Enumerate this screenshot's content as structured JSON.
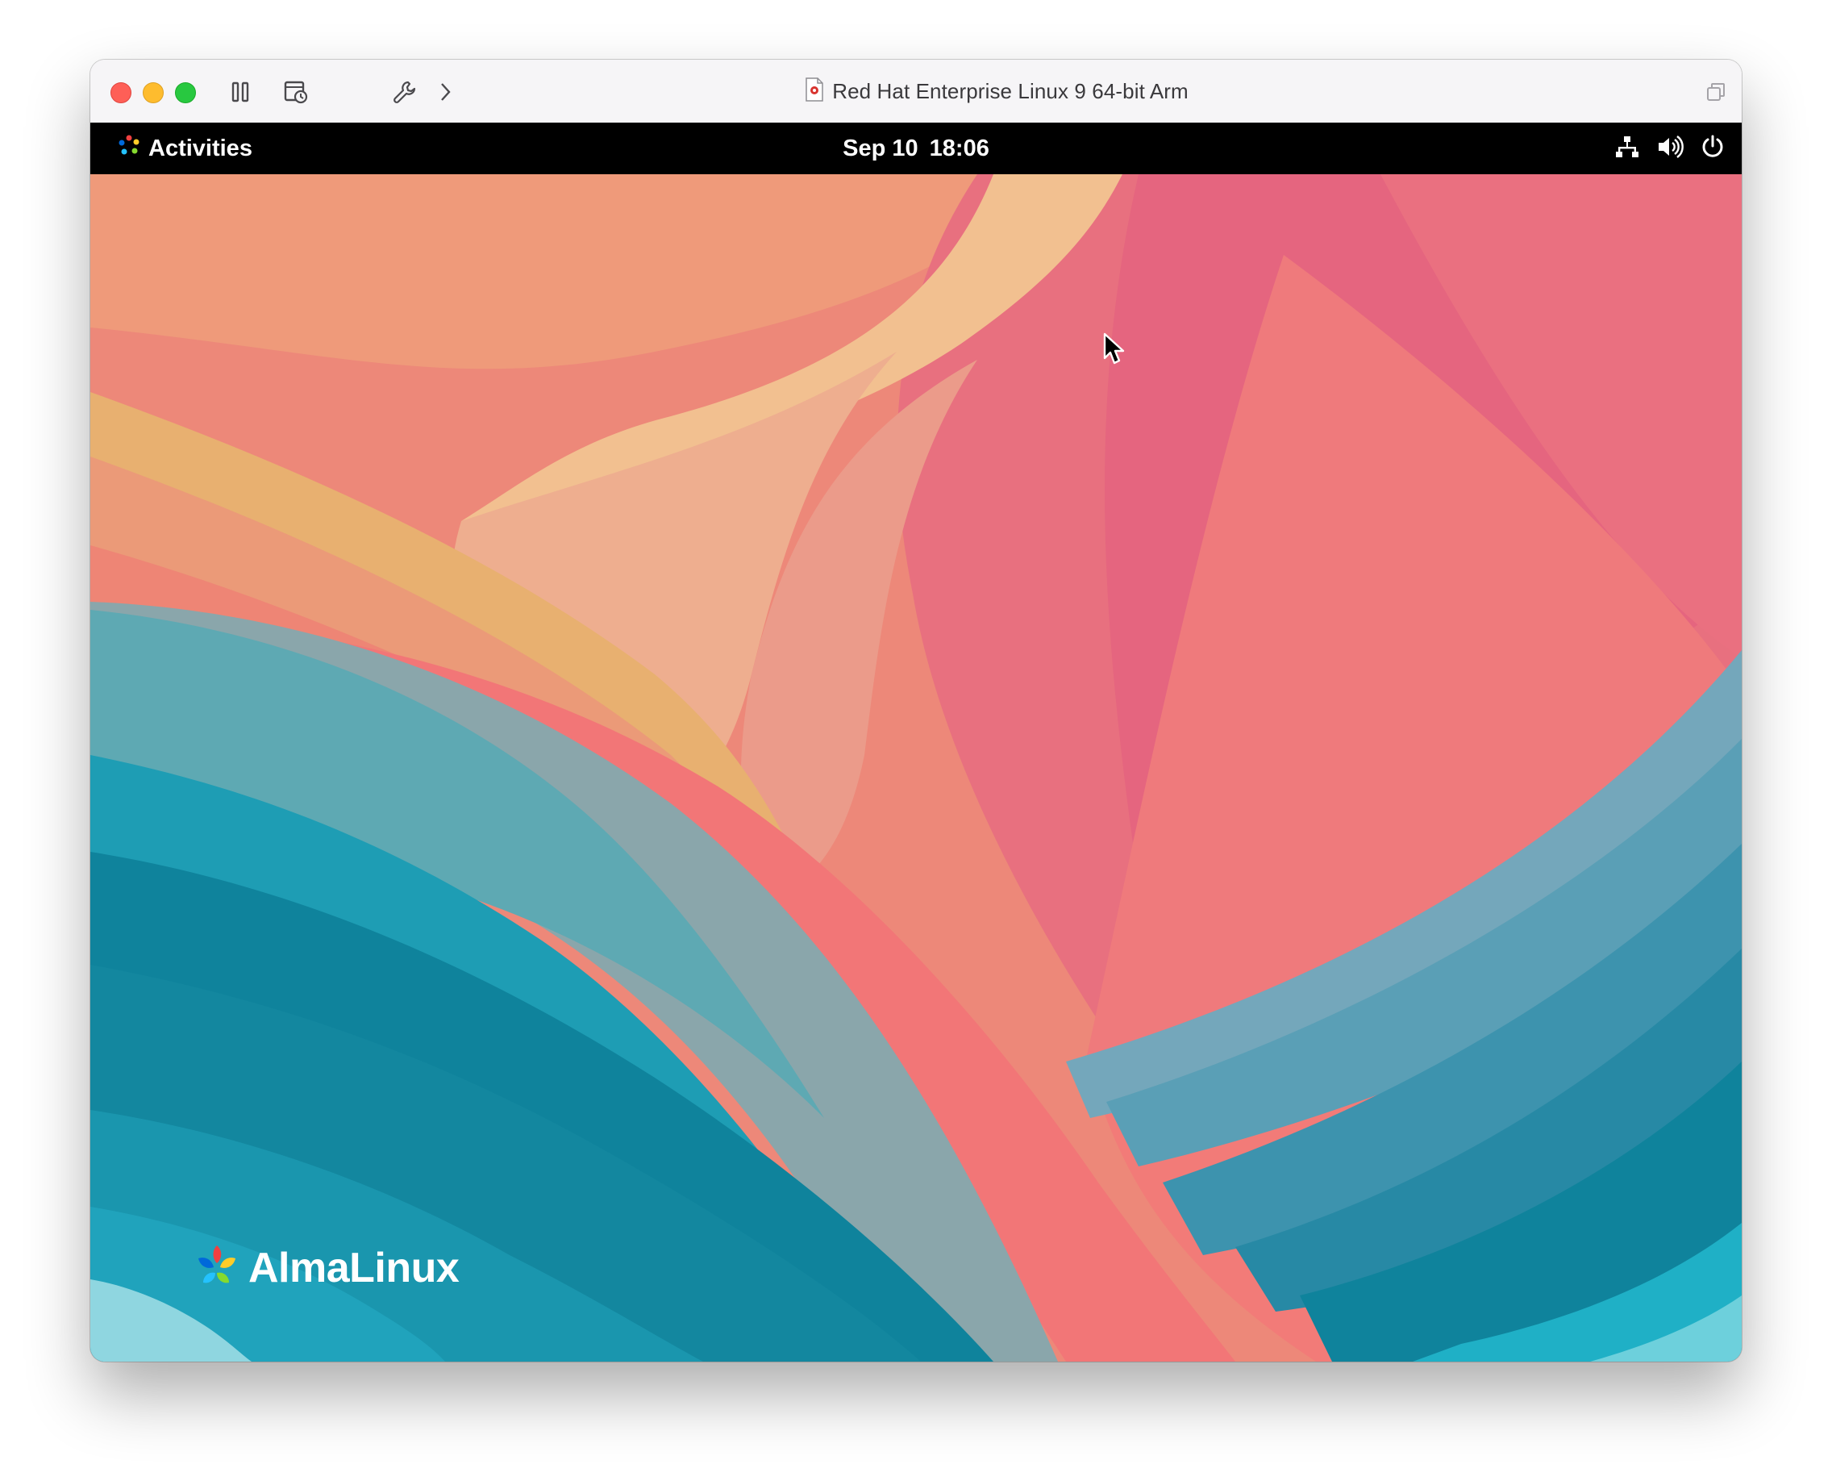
{
  "window": {
    "title": "Red Hat Enterprise Linux 9 64-bit Arm",
    "toolbar": {
      "pause_icon": "pause-icon",
      "snapshot_icon": "snapshot-icon",
      "settings_icon": "wrench-icon",
      "more_icon": "chevron-right-icon",
      "restore_icon": "window-restore-icon"
    }
  },
  "gnome_topbar": {
    "activities_label": "Activities",
    "date": "Sep 10",
    "time": "18:06",
    "status_icons": [
      "network-wired-icon",
      "volume-icon",
      "power-icon"
    ]
  },
  "desktop": {
    "brand_text": "AlmaLinux",
    "colors": {
      "peach": "#f0c08e",
      "salmon": "#ee8a78",
      "pink": "#e4687f",
      "coral": "#f27a78",
      "teal_dark": "#0f839c",
      "teal_light": "#24a6bd",
      "slate": "#88a5aa"
    }
  }
}
